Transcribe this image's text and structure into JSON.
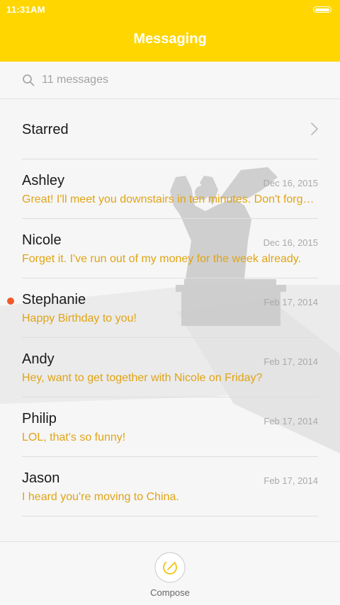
{
  "status_bar": {
    "time": "11:31AM",
    "battery_icon": "battery-icon"
  },
  "header": {
    "title": "Messaging"
  },
  "search": {
    "placeholder": "11 messages",
    "icon": "search-icon"
  },
  "starred": {
    "label": "Starred",
    "icon": "chevron-right-icon"
  },
  "messages": [
    {
      "name": "Ashley",
      "date": "Dec 16, 2015",
      "preview": "Great! I'll meet you downstairs in ten minutes. Don't forget your umbrella.",
      "unread": false
    },
    {
      "name": "Nicole",
      "date": "Dec 16, 2015",
      "preview": "Forget it. I've run out of my money for the week already.",
      "unread": false
    },
    {
      "name": "Stephanie",
      "date": "Feb 17, 2014",
      "preview": "Happy Birthday to you!",
      "unread": true
    },
    {
      "name": "Andy",
      "date": "Feb 17, 2014",
      "preview": "Hey, want to get together with Nicole on Friday?",
      "unread": false
    },
    {
      "name": "Philip",
      "date": "Feb 17, 2014",
      "preview": "LOL, that's so funny!",
      "unread": false
    },
    {
      "name": "Jason",
      "date": "Feb 17, 2014",
      "preview": "I heard you're moving to China.",
      "unread": false
    }
  ],
  "compose": {
    "label": "Compose",
    "icon": "compose-icon"
  },
  "colors": {
    "accent": "#ffd600",
    "preview_text": "#e0a415",
    "unread_dot": "#f1592a"
  }
}
